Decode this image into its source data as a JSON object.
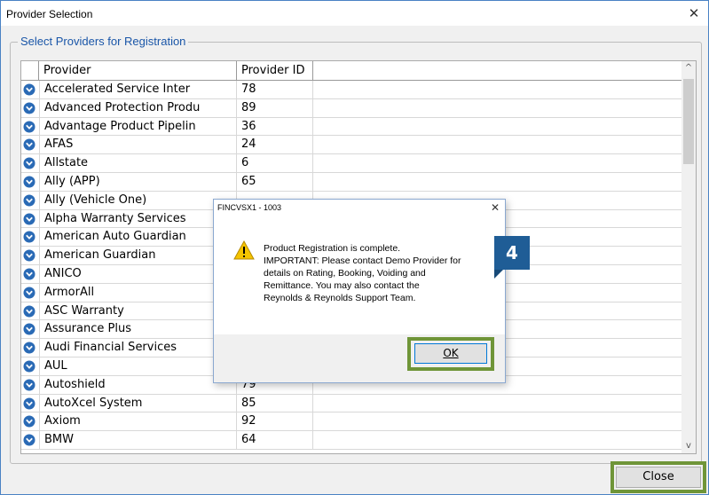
{
  "window": {
    "title": "Provider Selection",
    "close_glyph": "✕"
  },
  "group": {
    "legend": "Select Providers for Registration"
  },
  "grid": {
    "columns": [
      "Provider",
      "Provider ID"
    ],
    "rows": [
      {
        "provider": "Accelerated Service Inter",
        "id": "78"
      },
      {
        "provider": "Advanced Protection Produ",
        "id": "89"
      },
      {
        "provider": "Advantage Product Pipelin",
        "id": "36"
      },
      {
        "provider": "AFAS",
        "id": "24"
      },
      {
        "provider": "Allstate",
        "id": "6"
      },
      {
        "provider": "Ally (APP)",
        "id": "65"
      },
      {
        "provider": "Ally (Vehicle One)",
        "id": ""
      },
      {
        "provider": "Alpha Warranty Services",
        "id": ""
      },
      {
        "provider": "American Auto Guardian",
        "id": ""
      },
      {
        "provider": "American Guardian",
        "id": ""
      },
      {
        "provider": "ANICO",
        "id": ""
      },
      {
        "provider": "ArmorAll",
        "id": ""
      },
      {
        "provider": "ASC Warranty",
        "id": ""
      },
      {
        "provider": "Assurance Plus",
        "id": ""
      },
      {
        "provider": "Audi Financial Services",
        "id": ""
      },
      {
        "provider": "AUL",
        "id": ""
      },
      {
        "provider": "Autoshield",
        "id": "79"
      },
      {
        "provider": "AutoXcel System",
        "id": "85"
      },
      {
        "provider": "Axiom",
        "id": "92"
      },
      {
        "provider": "BMW",
        "id": "64"
      }
    ],
    "row_icon": "chevron-circle-icon",
    "scroll_up": "^",
    "scroll_down": "v"
  },
  "close_button": {
    "label": "Close"
  },
  "dialog": {
    "title": "FINCVSX1 - 1003",
    "close_glyph": "✕",
    "icon": "warning-icon",
    "message_lines": [
      "Product Registration is complete.",
      "IMPORTANT: Please contact Demo Provider for",
      "details on Rating, Booking, Voiding and",
      "Remittance. You may also contact the",
      "Reynolds & Reynolds Support Team."
    ],
    "ok_label": "OK"
  },
  "step_badge": {
    "label": "4"
  },
  "colors": {
    "highlight": "#6f9538",
    "badge": "#1f5d96",
    "legend_text": "#1a56a8",
    "row_icon": "#2a6ab5"
  }
}
